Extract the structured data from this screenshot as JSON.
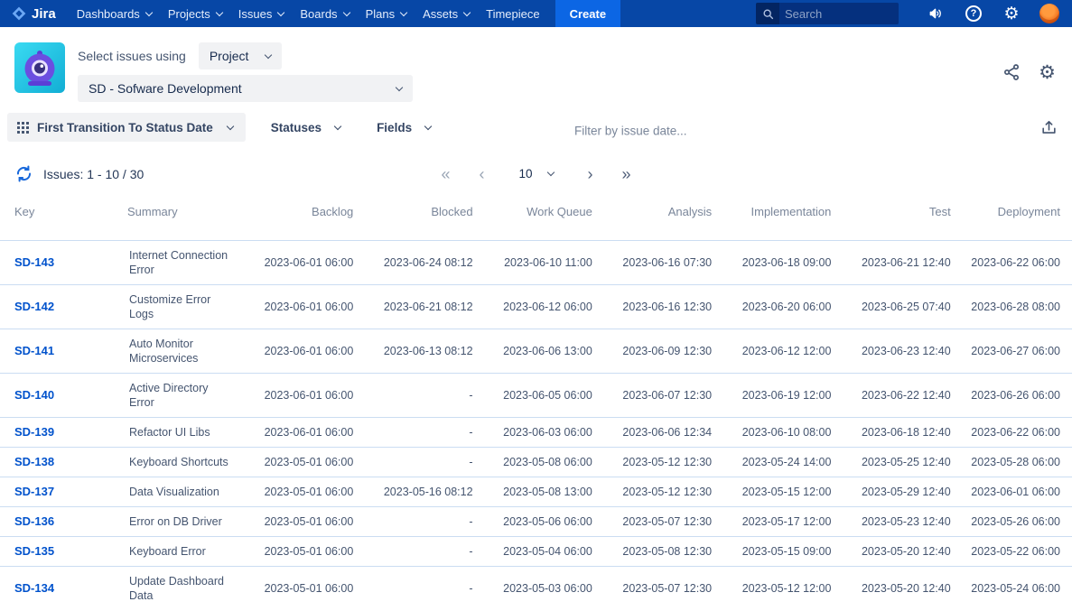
{
  "nav": {
    "logo_label": "Jira",
    "items": [
      {
        "label": "Dashboards"
      },
      {
        "label": "Projects"
      },
      {
        "label": "Issues"
      },
      {
        "label": "Boards"
      },
      {
        "label": "Plans"
      },
      {
        "label": "Assets"
      },
      {
        "label": "Timepiece"
      }
    ],
    "create_label": "Create",
    "search_placeholder": "Search"
  },
  "header": {
    "select_issues_label": "Select issues using",
    "issue_source_value": "Project",
    "project_value": "SD - Sofware Development"
  },
  "toolbar": {
    "report_name": "First Transition To Status Date",
    "statuses_label": "Statuses",
    "fields_label": "Fields",
    "date_filter_placeholder": "Filter by issue date..."
  },
  "pagination": {
    "issues_count_label": "Issues: 1 - 10 / 30",
    "first_glyph": "«",
    "prev_glyph": "‹",
    "page_size_value": "10",
    "next_glyph": "›",
    "last_glyph": "»"
  },
  "table": {
    "columns": [
      "Key",
      "Summary",
      "Backlog",
      "Blocked",
      "Work Queue",
      "Analysis",
      "Implementation",
      "Test",
      "Deployment"
    ],
    "rows": [
      {
        "key": "SD-143",
        "summary": "Internet Connection Error",
        "dates": [
          "2023-06-01 06:00",
          "2023-06-24 08:12",
          "2023-06-10 11:00",
          "2023-06-16 07:30",
          "2023-06-18 09:00",
          "2023-06-21 12:40",
          "2023-06-22 06:00"
        ]
      },
      {
        "key": "SD-142",
        "summary": "Customize Error Logs",
        "dates": [
          "2023-06-01 06:00",
          "2023-06-21 08:12",
          "2023-06-12 06:00",
          "2023-06-16 12:30",
          "2023-06-20 06:00",
          "2023-06-25 07:40",
          "2023-06-28 08:00"
        ]
      },
      {
        "key": "SD-141",
        "summary": "Auto Monitor Microservices",
        "dates": [
          "2023-06-01 06:00",
          "2023-06-13 08:12",
          "2023-06-06 13:00",
          "2023-06-09 12:30",
          "2023-06-12 12:00",
          "2023-06-23 12:40",
          "2023-06-27 06:00"
        ]
      },
      {
        "key": "SD-140",
        "summary": "Active Directory Error",
        "dates": [
          "2023-06-01 06:00",
          "-",
          "2023-06-05 06:00",
          "2023-06-07 12:30",
          "2023-06-19 12:00",
          "2023-06-22 12:40",
          "2023-06-26 06:00"
        ]
      },
      {
        "key": "SD-139",
        "summary": "Refactor UI Libs",
        "dates": [
          "2023-06-01 06:00",
          "-",
          "2023-06-03 06:00",
          "2023-06-06 12:34",
          "2023-06-10 08:00",
          "2023-06-18 12:40",
          "2023-06-22 06:00"
        ]
      },
      {
        "key": "SD-138",
        "summary": "Keyboard Shortcuts",
        "dates": [
          "2023-05-01 06:00",
          "-",
          "2023-05-08 06:00",
          "2023-05-12 12:30",
          "2023-05-24 14:00",
          "2023-05-25 12:40",
          "2023-05-28 06:00"
        ]
      },
      {
        "key": "SD-137",
        "summary": "Data Visualization",
        "dates": [
          "2023-05-01 06:00",
          "2023-05-16 08:12",
          "2023-05-08 13:00",
          "2023-05-12 12:30",
          "2023-05-15 12:00",
          "2023-05-29 12:40",
          "2023-06-01 06:00"
        ]
      },
      {
        "key": "SD-136",
        "summary": "Error on DB Driver",
        "dates": [
          "2023-05-01 06:00",
          "-",
          "2023-05-06 06:00",
          "2023-05-07 12:30",
          "2023-05-17 12:00",
          "2023-05-23 12:40",
          "2023-05-26 06:00"
        ]
      },
      {
        "key": "SD-135",
        "summary": "Keyboard Error",
        "dates": [
          "2023-05-01 06:00",
          "-",
          "2023-05-04 06:00",
          "2023-05-08 12:30",
          "2023-05-15 09:00",
          "2023-05-20 12:40",
          "2023-05-22 06:00"
        ]
      },
      {
        "key": "SD-134",
        "summary": "Update Dashboard Data",
        "dates": [
          "2023-05-01 06:00",
          "-",
          "2023-05-03 06:00",
          "2023-05-07 12:30",
          "2023-05-12 12:00",
          "2023-05-20 12:40",
          "2023-05-24 06:00"
        ]
      }
    ]
  },
  "colors": {
    "nav_background": "#0747A6",
    "create_button": "#0C66E4",
    "link_blue": "#0052CC",
    "row_divider": "#CBDDF2",
    "app_icon_teal": "#25C2DE",
    "avatar_orange": "#E8590C",
    "muted_text": "#7A869A"
  }
}
